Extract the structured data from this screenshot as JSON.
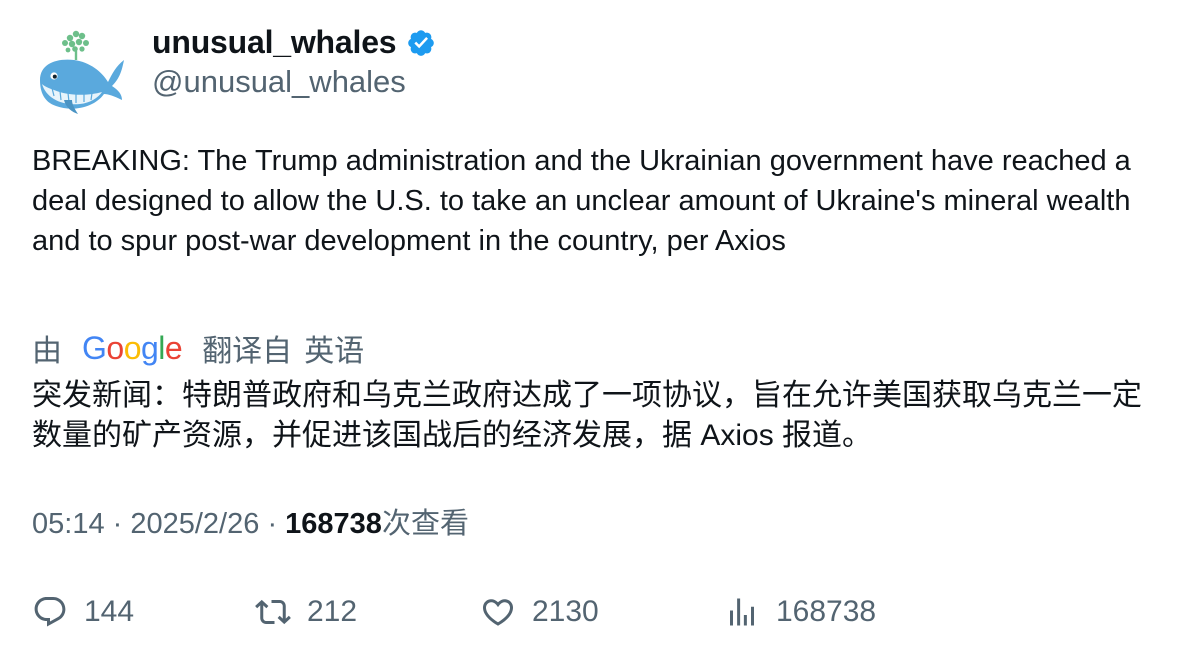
{
  "author": {
    "display_name": "unusual_whales",
    "handle": "@unusual_whales",
    "verified": true,
    "verified_icon": "verified-badge-icon",
    "verified_color": "#1D9BF0",
    "avatar_icon": "whale-avatar-icon"
  },
  "tweet": {
    "text": "BREAKING: The Trump administration and the Ukrainian government have reached a deal designed to allow the U.S. to take an unclear amount of Ukraine's mineral wealth and to spur post-war development in the country, per Axios"
  },
  "translation": {
    "prefix": "由",
    "provider_logo": "Google",
    "from_label": "翻译自",
    "language": "英语",
    "text": "突发新闻：特朗普政府和乌克兰政府达成了一项协议，旨在允许美国获取乌克兰一定数量的矿产资源，并促进该国战后的经济发展，据 Axios 报道。"
  },
  "meta": {
    "time": "05:14",
    "separator": "·",
    "date": "2025/2/26",
    "views_count": "168738",
    "views_label": "次查看"
  },
  "actions": {
    "reply": {
      "icon": "reply-icon",
      "count": "144"
    },
    "retweet": {
      "icon": "retweet-icon",
      "count": "212"
    },
    "like": {
      "icon": "heart-icon",
      "count": "2130"
    },
    "views": {
      "icon": "analytics-icon",
      "count": "168738"
    }
  },
  "colors": {
    "text_primary": "#0f1419",
    "text_secondary": "#536471",
    "google_blue": "#4285F4",
    "google_red": "#EA4335",
    "google_yellow": "#FBBC05",
    "google_green": "#34A853"
  }
}
